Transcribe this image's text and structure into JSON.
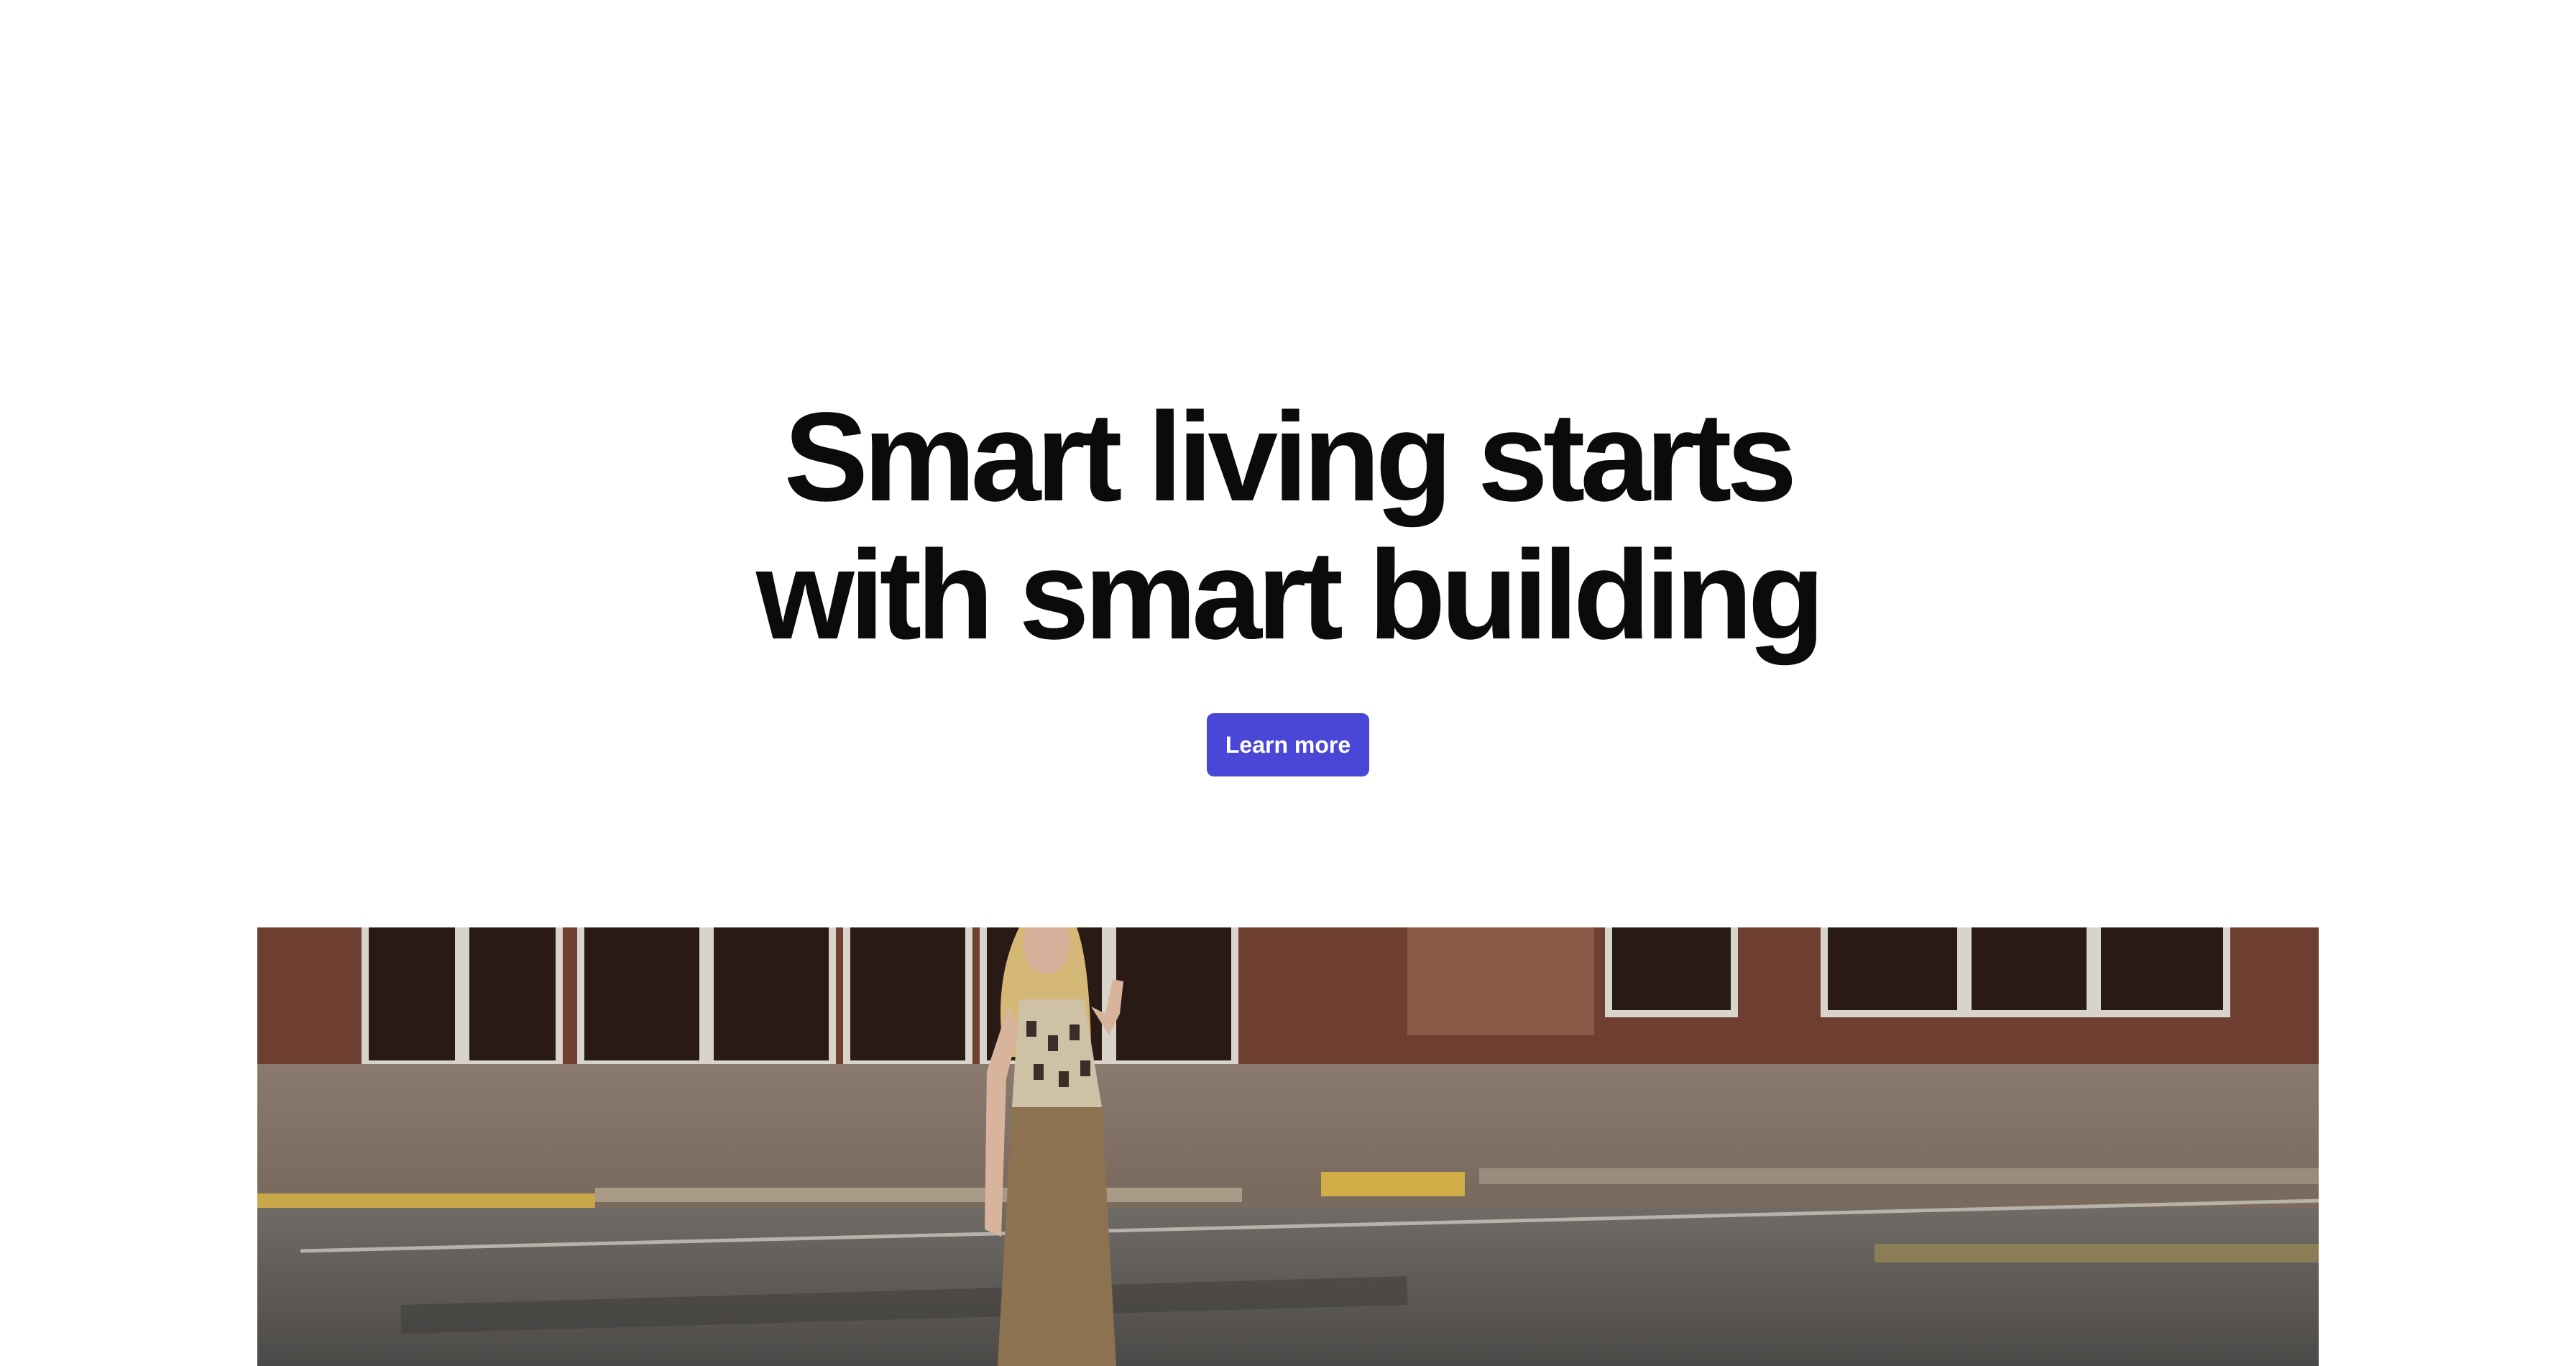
{
  "hero": {
    "headline_line1": "Smart living starts",
    "headline_line2": "with smart building",
    "cta_label": "Learn more"
  },
  "colors": {
    "accent": "#4a46d8",
    "text": "#0b0b0d",
    "background": "#ffffff"
  },
  "photo": {
    "description_icon": "street-photo"
  }
}
